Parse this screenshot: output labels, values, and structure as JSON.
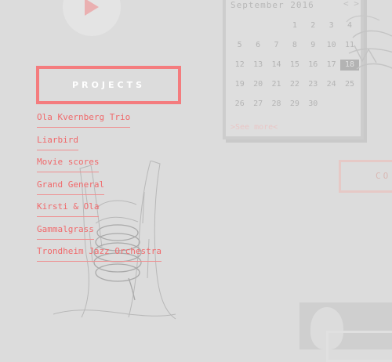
{
  "media": {
    "play_icon": "play-icon"
  },
  "calendar": {
    "month_label": "September 2016",
    "nav": "< >",
    "days": [
      "",
      "",
      "",
      "1",
      "2",
      "3",
      "4",
      "5",
      "6",
      "7",
      "8",
      "9",
      "10",
      "11",
      "12",
      "13",
      "14",
      "15",
      "16",
      "17",
      "18",
      "19",
      "20",
      "21",
      "22",
      "23",
      "24",
      "25",
      "26",
      "27",
      "28",
      "29",
      "30",
      "",
      ""
    ],
    "selected_day": "18",
    "see_more": ">See more<"
  },
  "side_button": {
    "label": "CO"
  },
  "projects": {
    "title": "PROJECTS",
    "items": [
      "Ola Kvernberg Trio",
      "Liarbird",
      "Movie scores",
      "Grand General",
      "Kirsti & Ola",
      "Gammalgrass",
      "Trondheim Jazz Orchestra"
    ]
  },
  "colors": {
    "accent": "#f47c7e",
    "background": "#dcdcdc"
  }
}
